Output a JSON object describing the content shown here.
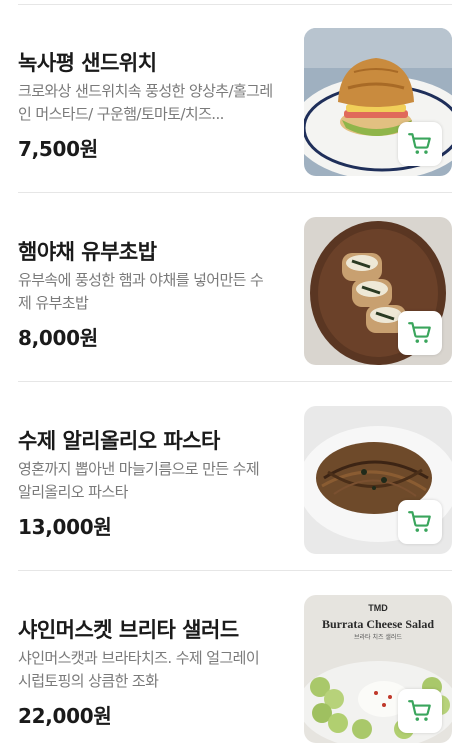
{
  "colors": {
    "accent": "#3aa55c",
    "price": "#1a1a1a",
    "desc": "#7a7a7a",
    "divider": "#e6e6e6"
  },
  "menu": {
    "items": [
      {
        "name": "녹사평 샌드위치",
        "description": "크로와상 샌드위치속 풍성한 양상추/홀그레인 머스타드/ 구운햄/토마토/치즈...",
        "price": "7,500원",
        "image_icon": "croissant-sandwich-photo",
        "cart_icon": "cart-icon"
      },
      {
        "name": "햄야채 유부초밥",
        "description": "유부속에 풍성한 햄과 야채를 넣어만든 수제 유부초밥",
        "price": "8,000원",
        "image_icon": "inari-sushi-photo",
        "cart_icon": "cart-icon"
      },
      {
        "name": "수제 알리올리오 파스타",
        "description": "영혼까지 뽑아낸 마늘기름으로 만든 수제 알리올리오 파스타",
        "price": "13,000원",
        "image_icon": "pasta-photo",
        "cart_icon": "cart-icon"
      },
      {
        "name": "샤인머스켓 브리타 샐러드",
        "description": "샤인머스캣과 브라타치즈. 수제 얼그레이 시럽토핑의 상큼한 조화",
        "price": "22,000원",
        "image_icon": "burrata-salad-photo",
        "image_caption_brand": "TMD",
        "image_caption_title": "Burrata Cheese Salad",
        "image_caption_sub": "브라타 치즈 샐러드",
        "cart_icon": "cart-icon"
      }
    ]
  }
}
